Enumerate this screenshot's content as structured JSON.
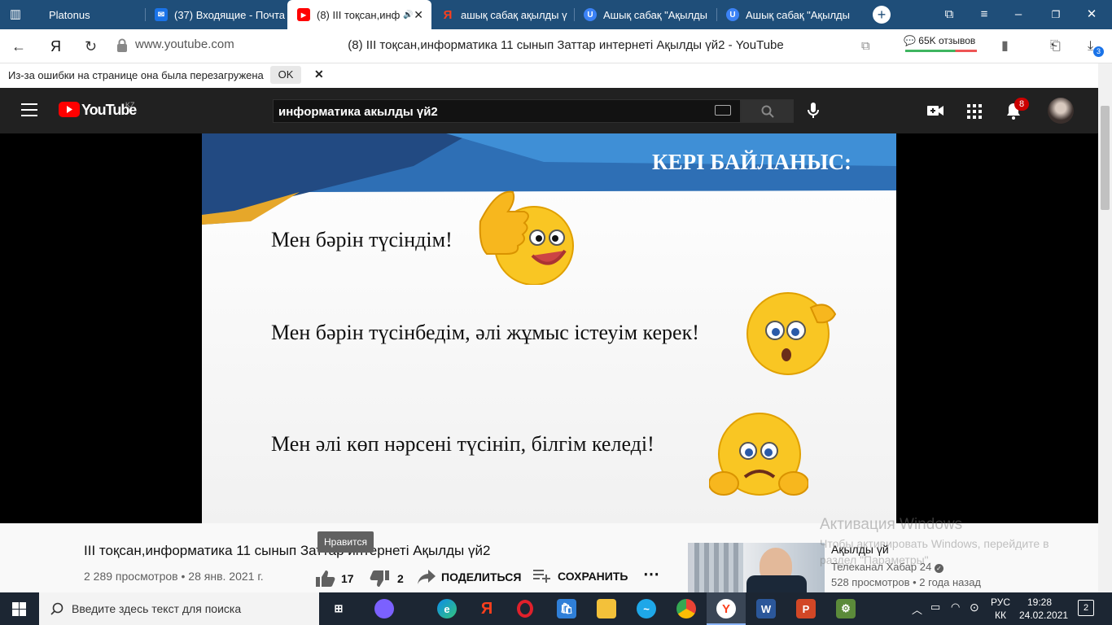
{
  "browser": {
    "tabs": [
      {
        "label": "Platonus",
        "favicon": "platonus-icon",
        "color": "#9aa7b4"
      },
      {
        "label": "(37) Входящие - Почта",
        "favicon": "mail-icon",
        "color": "#1a73e8"
      },
      {
        "label": "(8) III тоқсан,инф",
        "favicon": "youtube-icon",
        "color": "#ff0000",
        "active": true
      },
      {
        "label": "ашық сабақ ақылды ү",
        "favicon": "yandex-icon",
        "color": "#fc3f1d"
      },
      {
        "label": "Ашық сабақ \"Ақылды",
        "favicon": "ucoz-icon",
        "color": "#3b82f6"
      },
      {
        "label": "Ашық сабақ \"Ақылды",
        "favicon": "ucoz-icon",
        "color": "#3b82f6"
      }
    ],
    "url": "www.youtube.com",
    "page_title": "(8) III тоқсан,информатика 11 сынып Заттар интернеті Ақылды үй2 - YouTube",
    "reviews": "65K отзывов",
    "downloads_badge": "3",
    "info_bar": {
      "message": "Из-за ошибки на странице она была перезагружена",
      "ok_label": "OK"
    }
  },
  "youtube": {
    "logo_text": "YouTube",
    "region": "KZ",
    "search_value": "информатика акылды үй2",
    "notification_count": "8"
  },
  "slide": {
    "heading": "КЕРІ БАЙЛАНЫС:",
    "lines": [
      "Мен бәрін түсіндім!",
      "Мен бәрін түсінбедім, әлі жұмыс істеуім керек!",
      "Мен әлі көп нәрсені түсініп, білгім келеді!"
    ]
  },
  "video": {
    "title": "III тоқсан,информатика 11 сынып Заттар интернеті Ақылды үй2",
    "views": "2 289 просмотров",
    "date": "28 янв. 2021 г.",
    "likes": "17",
    "dislikes": "2",
    "share_label": "ПОДЕЛИТЬСЯ",
    "save_label": "СОХРАНИТЬ",
    "like_tooltip": "Нравится"
  },
  "recommendation": {
    "title": "Ақылды үй",
    "channel": "Телеканал Хабар 24",
    "views": "528 просмотров",
    "age": "2 года назад"
  },
  "watermark": {
    "title": "Активация Windows",
    "text": "Чтобы активировать Windows, перейдите в раздел \"Параметры\"."
  },
  "taskbar": {
    "search_placeholder": "Введите здесь текст для поиска",
    "lang_top": "РУС",
    "lang_bottom": "КК",
    "time": "19:28",
    "date": "24.02.2021",
    "notifications": "2"
  }
}
